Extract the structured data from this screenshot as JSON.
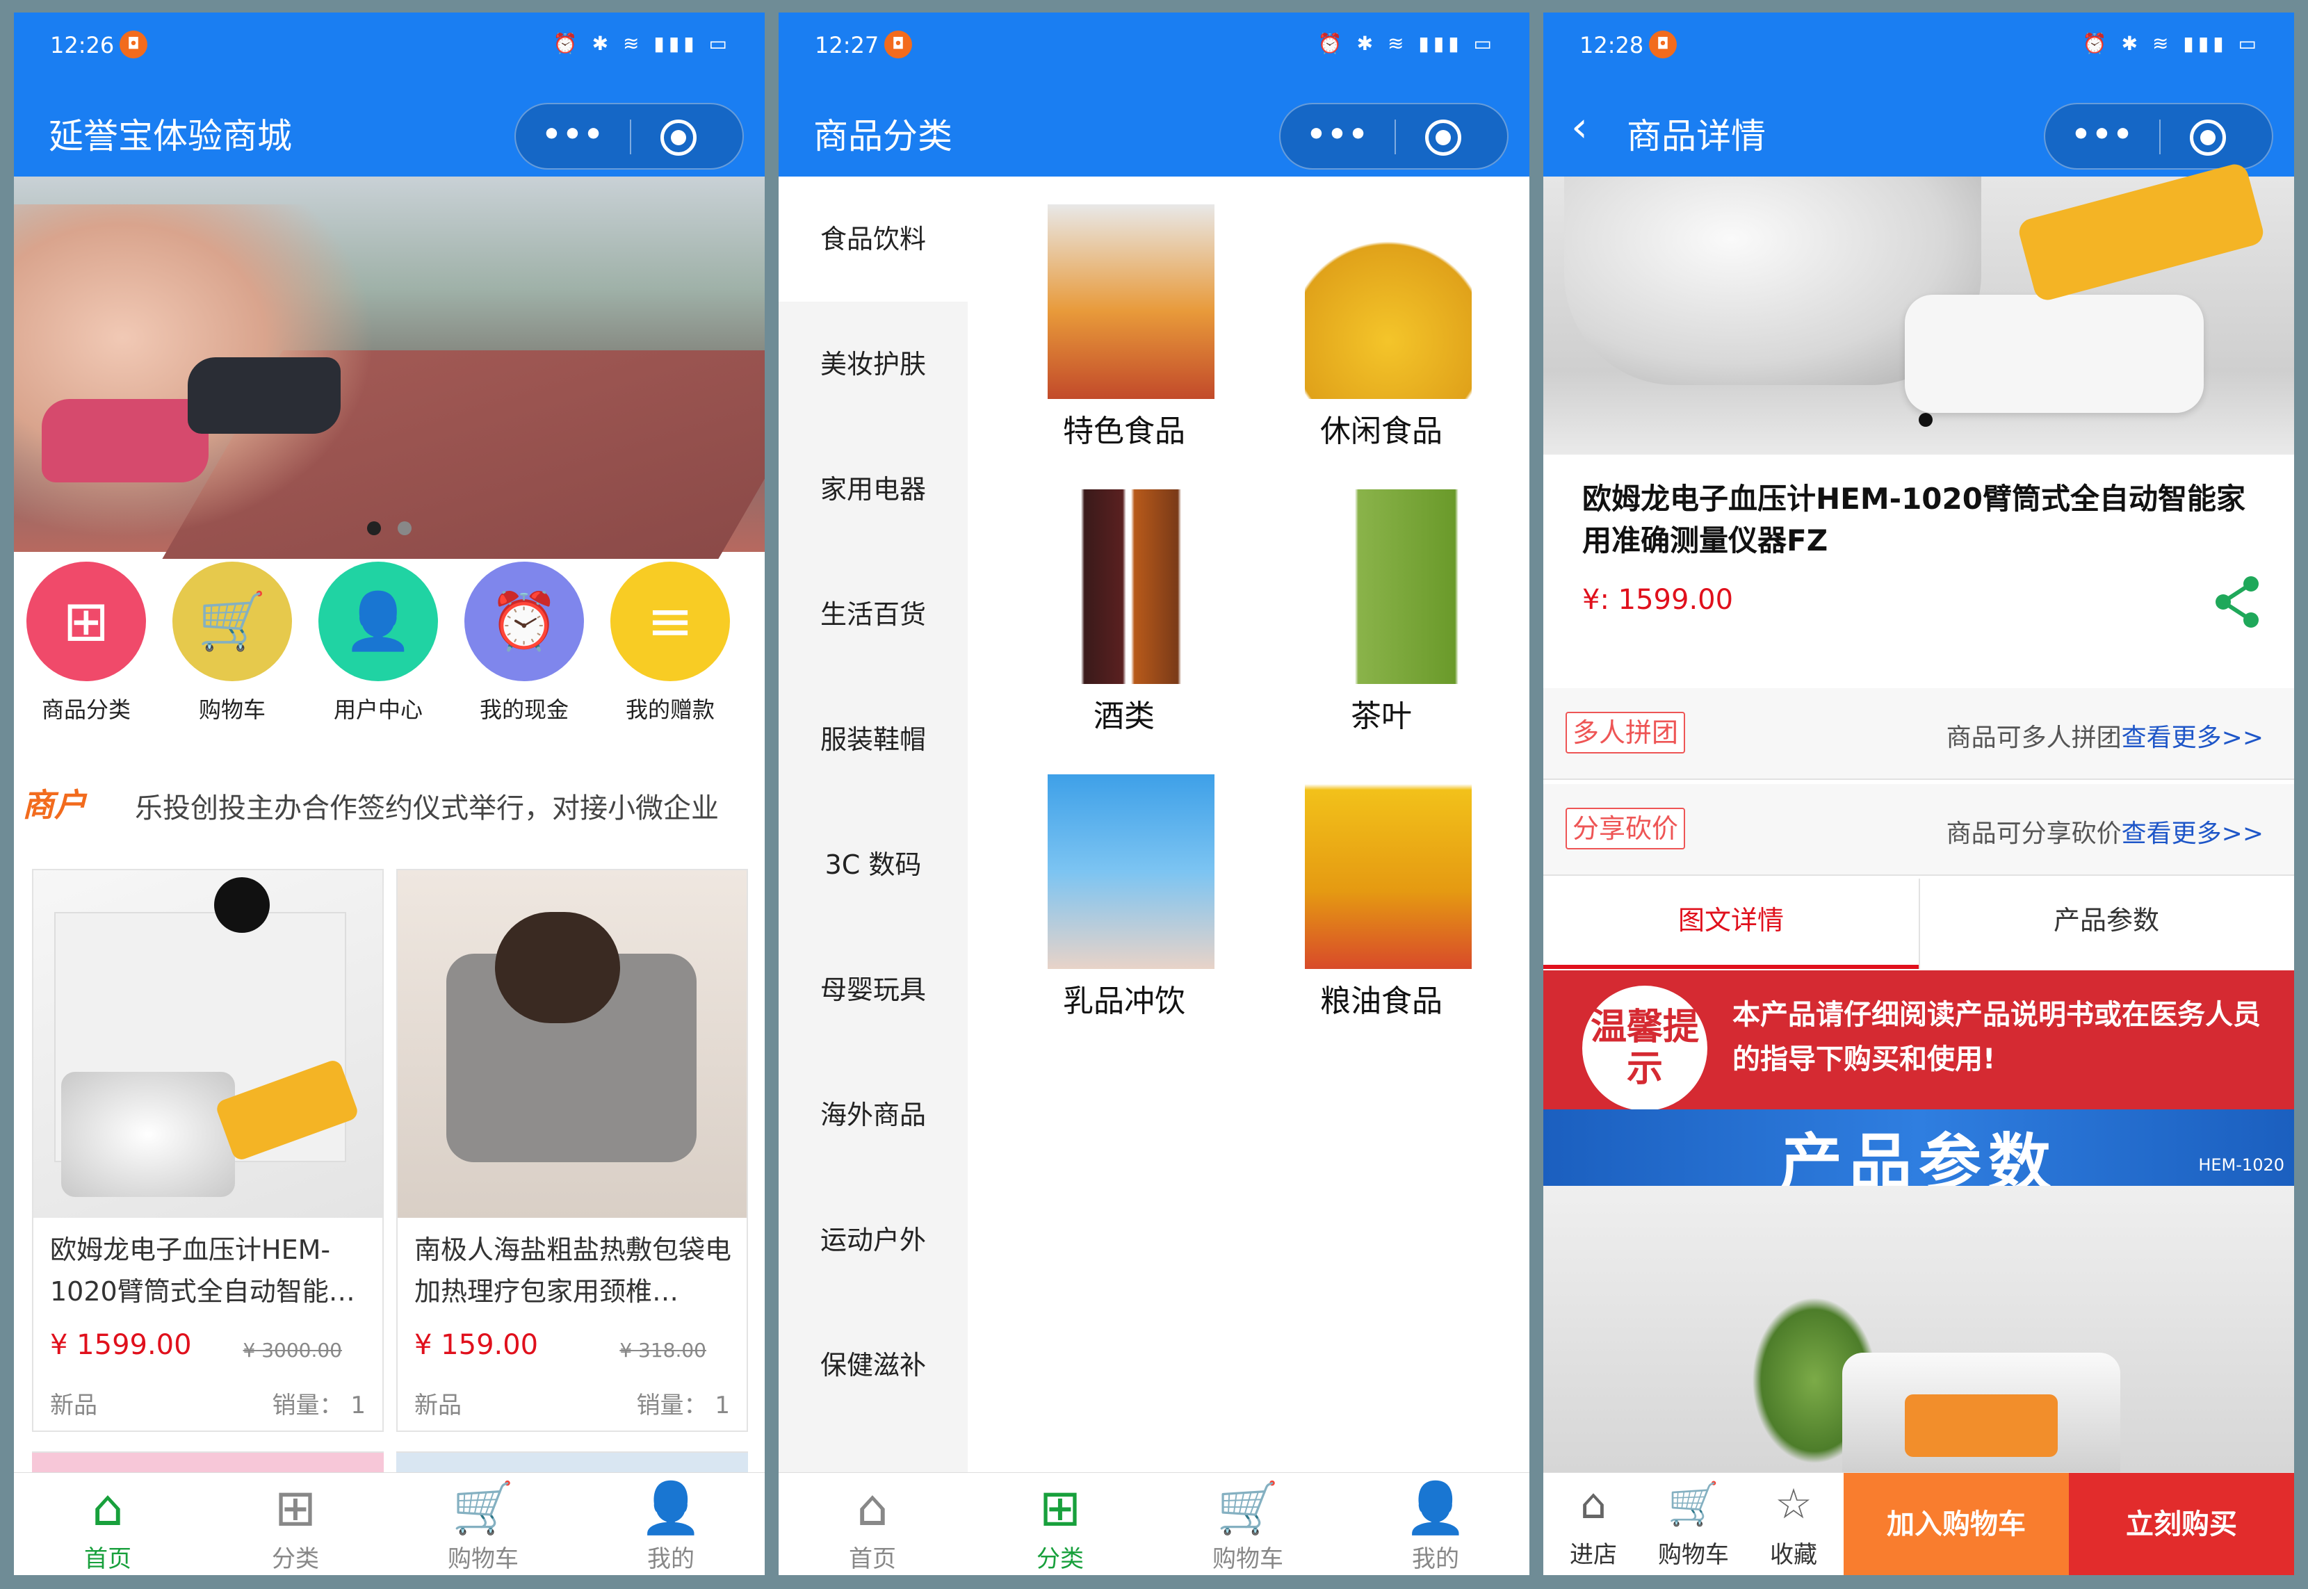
{
  "phone1": {
    "status": {
      "time": "12:26",
      "badge": "◘",
      "icons": "⏰ ✱ ≋ ▮▮▮ ▭"
    },
    "navbar": {
      "title": "延誉宝体验商城",
      "more": "•••"
    },
    "quick": [
      {
        "label": "商品分类",
        "icon": "⊞",
        "color": "#f04a6a"
      },
      {
        "label": "购物车",
        "icon": "🛒",
        "color": "#e6c94c"
      },
      {
        "label": "用户中心",
        "icon": "👤",
        "color": "#20d3a3"
      },
      {
        "label": "我的现金",
        "icon": "⏰",
        "color": "#7f86ec"
      },
      {
        "label": "我的赠款",
        "icon": "≡",
        "color": "#f8cc24"
      }
    ],
    "notice": {
      "tag": "商户",
      "text": "乐投创投主办合作签约仪式举行，对接小微企业"
    },
    "products": [
      {
        "name": "欧姆龙电子血压计HEM-1020臂筒式全自动智能…",
        "price": "¥ 1599.00",
        "old_price": "¥ 3000.00",
        "tag": "新品",
        "sales": "销量：  1"
      },
      {
        "name": "南极人海盐粗盐热敷包袋电加热理疗包家用颈椎…",
        "price": "¥ 159.00",
        "old_price": "¥ 318.00",
        "tag": "新品",
        "sales": "销量：  1"
      }
    ],
    "tabs": [
      {
        "label": "首页",
        "icon": "⌂"
      },
      {
        "label": "分类",
        "icon": "⊞"
      },
      {
        "label": "购物车",
        "icon": "🛒"
      },
      {
        "label": "我的",
        "icon": "👤"
      }
    ]
  },
  "phone2": {
    "status": {
      "time": "12:27",
      "badge": "◘",
      "icons": "⏰ ✱ ≋ ▮▮▮ ▭"
    },
    "navbar": {
      "title": "商品分类",
      "more": "•••"
    },
    "categories": [
      "食品饮料",
      "美妆护肤",
      "家用电器",
      "生活百货",
      "服装鞋帽",
      "3C 数码",
      "母婴玩具",
      "海外商品",
      "运动户外",
      "保健滋补"
    ],
    "items": [
      {
        "label": "特色食品"
      },
      {
        "label": "休闲食品"
      },
      {
        "label": "酒类"
      },
      {
        "label": "茶叶"
      },
      {
        "label": "乳品冲饮"
      },
      {
        "label": "粮油食品"
      }
    ],
    "tabs": [
      {
        "label": "首页",
        "icon": "⌂"
      },
      {
        "label": "分类",
        "icon": "⊞"
      },
      {
        "label": "购物车",
        "icon": "🛒"
      },
      {
        "label": "我的",
        "icon": "👤"
      }
    ]
  },
  "phone3": {
    "status": {
      "time": "12:28",
      "badge": "◘",
      "icons": "⏰ ✱ ≋ ▮▮▮ ▭"
    },
    "navbar": {
      "title": "商品详情",
      "back": "‹",
      "more": "•••"
    },
    "product": {
      "title": "欧姆龙电子血压计HEM-1020臂筒式全自动智能家用准确测量仪器FZ",
      "price": "¥:  1599.00"
    },
    "promos": [
      {
        "tag": "多人拼团",
        "text": "商品可多人拼团",
        "link": "查看更多>>"
      },
      {
        "tag": "分享砍价",
        "text": "商品可分享砍价",
        "link": "查看更多>>"
      }
    ],
    "detail_tabs": [
      "图文详情",
      "产品参数"
    ],
    "warning": {
      "badge": "温馨提示",
      "text": "本产品请仔细阅读产品说明书或在医务人员的指导下购买和使用!"
    },
    "params_banner": {
      "title": "产品参数",
      "model": "HEM-1020"
    },
    "actions": [
      {
        "label": "进店",
        "icon": "⌂"
      },
      {
        "label": "购物车",
        "icon": "🛒"
      },
      {
        "label": "收藏",
        "icon": "☆"
      }
    ],
    "add_to_cart": "加入购物车",
    "buy_now": "立刻购买"
  }
}
